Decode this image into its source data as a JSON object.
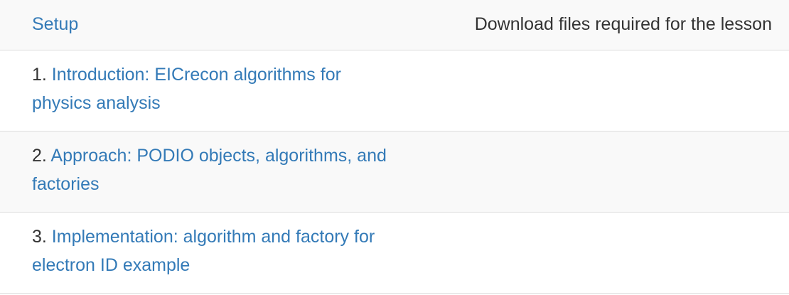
{
  "schedule": {
    "rows": [
      {
        "number": "",
        "title": "Setup",
        "description": "Download files required for the lesson"
      },
      {
        "number": "1.",
        "title": "Introduction: EICrecon algorithms for physics analysis",
        "description": ""
      },
      {
        "number": "2.",
        "title": "Approach: PODIO objects, algorithms, and factories",
        "description": ""
      },
      {
        "number": "3.",
        "title": "Implementation: algorithm and factory for electron ID example",
        "description": ""
      }
    ]
  },
  "colors": {
    "link": "#337ab7",
    "text": "#333333",
    "stripe": "#f9f9f9",
    "border": "#dddddd"
  }
}
